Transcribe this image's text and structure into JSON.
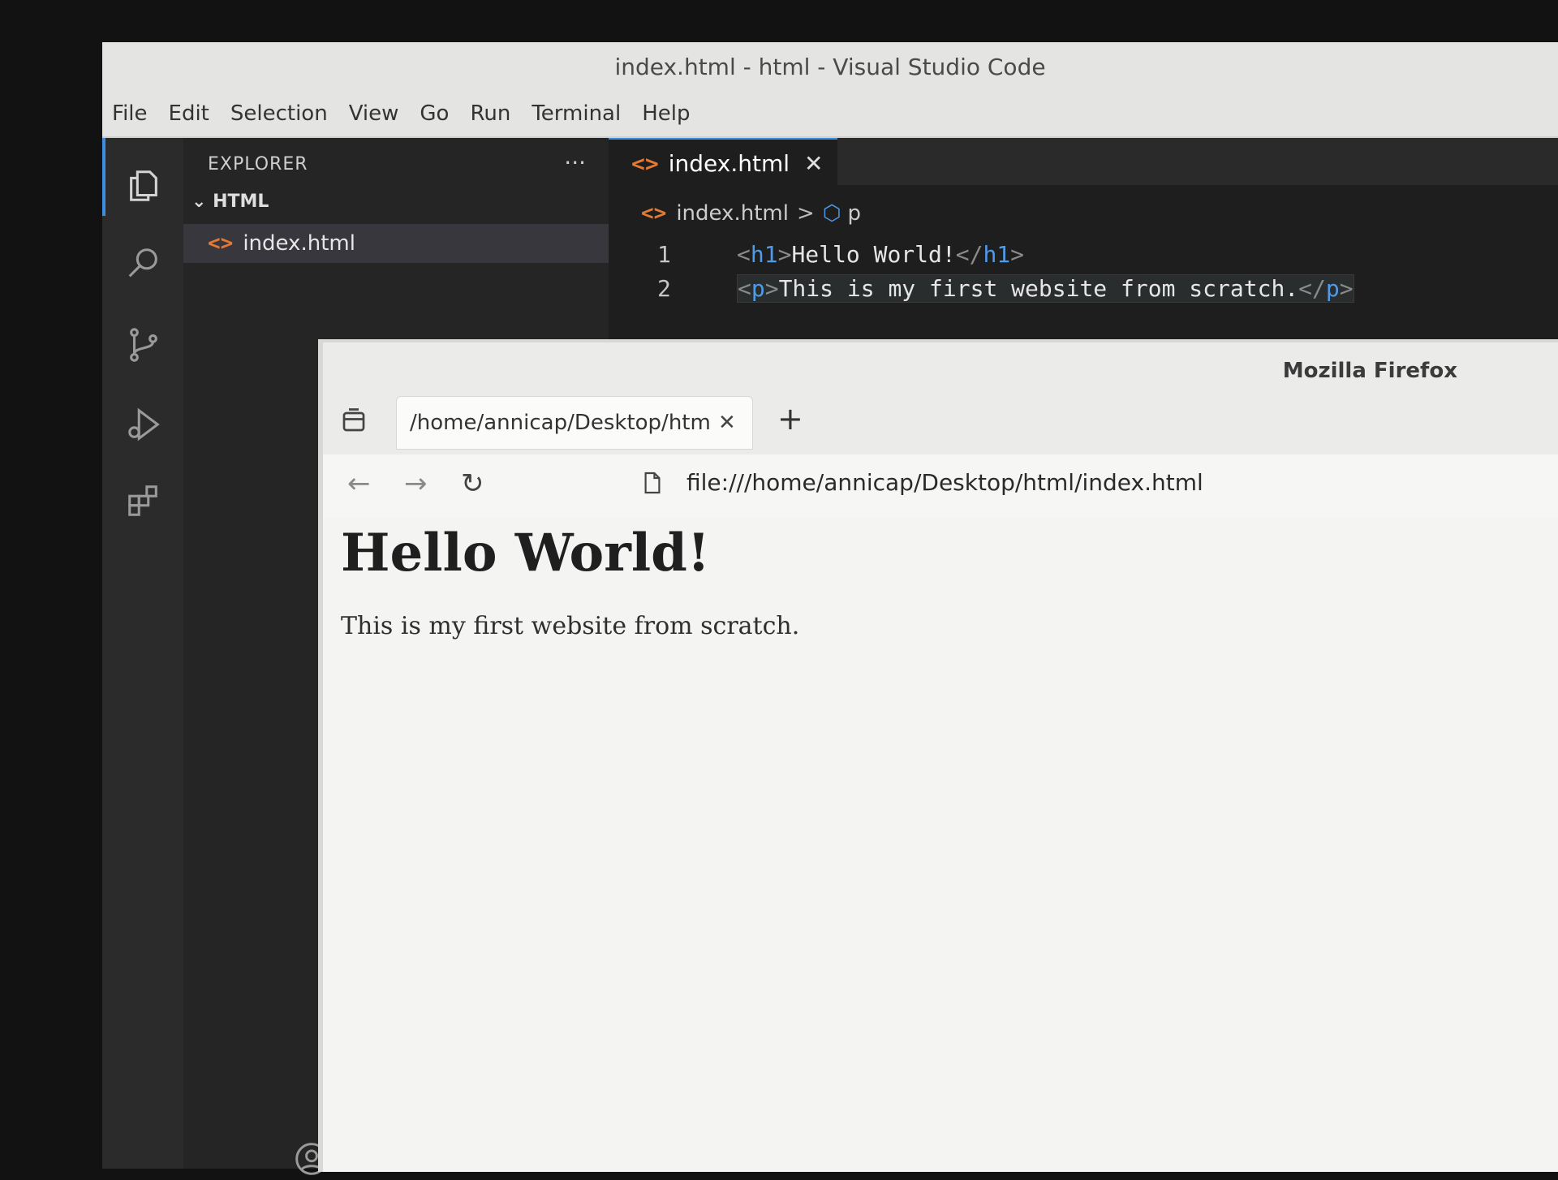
{
  "vscode": {
    "window_title": "index.html - html - Visual Studio Code",
    "menu": [
      "File",
      "Edit",
      "Selection",
      "View",
      "Go",
      "Run",
      "Terminal",
      "Help"
    ],
    "sidebar": {
      "title": "EXPLORER",
      "more": "···",
      "folder": "HTML",
      "file": "index.html"
    },
    "tab": {
      "label": "index.html",
      "close": "✕"
    },
    "breadcrumb": {
      "file": "index.html",
      "sep": ">",
      "symbol": "p"
    },
    "code": {
      "line1": {
        "num": "1",
        "open": "h1",
        "text": "Hello World!",
        "close": "h1"
      },
      "line2": {
        "num": "2",
        "open": "p",
        "text": "This is my first website from scratch.",
        "close": "p"
      }
    },
    "icons": [
      "files-icon",
      "search-icon",
      "source-control-icon",
      "run-debug-icon",
      "extensions-icon",
      "account-icon"
    ],
    "accent": "#3c8fe0"
  },
  "firefox": {
    "window_title": "Mozilla Firefox",
    "tab_title": "/home/annicap/Desktop/html/index.html",
    "tab_close": "✕",
    "new_tab": "+",
    "nav": {
      "back": "←",
      "forward": "→",
      "reload": "↻"
    },
    "url": "file:///home/annicap/Desktop/html/index.html",
    "page": {
      "heading": "Hello World!",
      "paragraph": "This is my first website from scratch."
    }
  }
}
